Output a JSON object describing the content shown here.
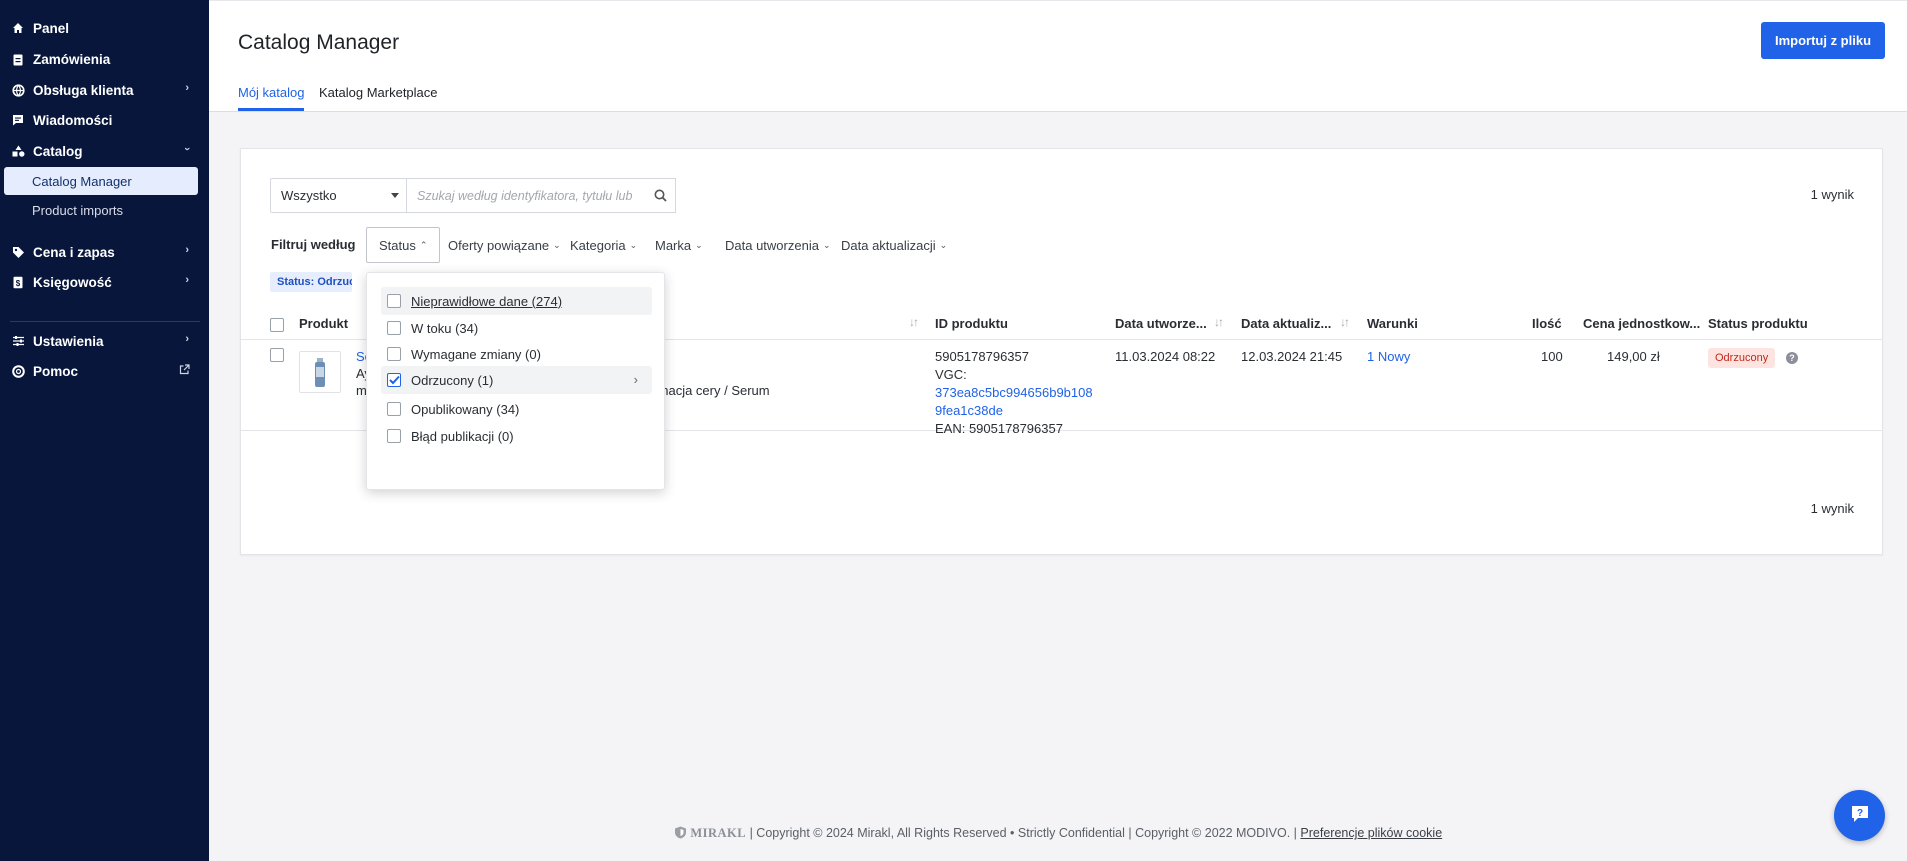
{
  "sidebar": {
    "items": [
      {
        "label": "Panel",
        "icon": "home-icon"
      },
      {
        "label": "Zamówienia",
        "icon": "clipboard-icon"
      },
      {
        "label": "Obsługa klienta",
        "icon": "globe-icon"
      },
      {
        "label": "Wiadomości",
        "icon": "message-icon"
      },
      {
        "label": "Catalog",
        "icon": "shapes-icon"
      },
      {
        "label": "Cena i zapas",
        "icon": "tag-icon"
      },
      {
        "label": "Księgowość",
        "icon": "ledger-icon"
      },
      {
        "label": "Ustawienia",
        "icon": "sliders-icon"
      },
      {
        "label": "Pomoc",
        "icon": "lifebuoy-icon"
      }
    ],
    "catalog_sub": [
      {
        "label": "Catalog Manager",
        "active": true
      },
      {
        "label": "Product imports",
        "active": false
      }
    ]
  },
  "header": {
    "title": "Catalog Manager",
    "import_button": "Importuj z pliku",
    "tabs": [
      {
        "label": "Mój katalog",
        "active": true
      },
      {
        "label": "Katalog Marketplace",
        "active": false
      }
    ]
  },
  "search": {
    "scope": "Wszystko",
    "placeholder": "Szukaj według identyfikatora, tytułu lub",
    "result_count": "1 wynik"
  },
  "filters": {
    "label": "Filtruj według",
    "buttons": [
      "Status",
      "Oferty powiązane",
      "Kategoria",
      "Marka",
      "Data utworzenia",
      "Data aktualizacji"
    ],
    "active_chip": "Status: Odrzucony"
  },
  "status_dropdown": {
    "options": [
      {
        "label": "Nieprawidłowe dane (274)",
        "checked": false
      },
      {
        "label": "W toku (34)",
        "checked": false
      },
      {
        "label": "Wymagane zmiany (0)",
        "checked": false
      },
      {
        "label": "Odrzucony (1)",
        "checked": true
      },
      {
        "label": "Opublikowany (34)",
        "checked": false
      },
      {
        "label": "Błąd publikacji (0)",
        "checked": false
      }
    ]
  },
  "table": {
    "columns": {
      "product": "Produkt",
      "product_id": "ID produktu",
      "created": "Data utworze...",
      "updated": "Data aktualiz...",
      "conditions": "Warunki",
      "quantity": "Ilość",
      "unit_price": "Cena jednostkow...",
      "status": "Status produktu"
    },
    "row": {
      "title_fragment": "Se",
      "line2_fragment": "Ay",
      "line3_fragment": "m",
      "category": "gnacja cery / Serum",
      "product_id": "5905178796357",
      "vgc_label": "VGC:",
      "vgc_line1": "373ea8c5bc994656b9b108",
      "vgc_line2": "9fea1c38de",
      "ean": "EAN: 5905178796357",
      "created": "11.03.2024 08:22",
      "updated": "12.03.2024 21:45",
      "conditions": "1 Nowy",
      "quantity": "100",
      "unit_price": "149,00 zł",
      "status": "Odrzucony"
    },
    "bottom_count": "1 wynik"
  },
  "footer": {
    "logo": "MIRAKL",
    "text": "| Copyright © 2024 Mirakl, All Rights Reserved • Strictly Confidential | Copyright © 2022 MODIVO.  |",
    "cookie_link": "Preferencje plików cookie"
  },
  "colors": {
    "sidebar_bg": "#07163a",
    "accent": "#2062e8",
    "status_rejected_bg": "#fde4e1",
    "status_rejected_text": "#c1291c"
  }
}
